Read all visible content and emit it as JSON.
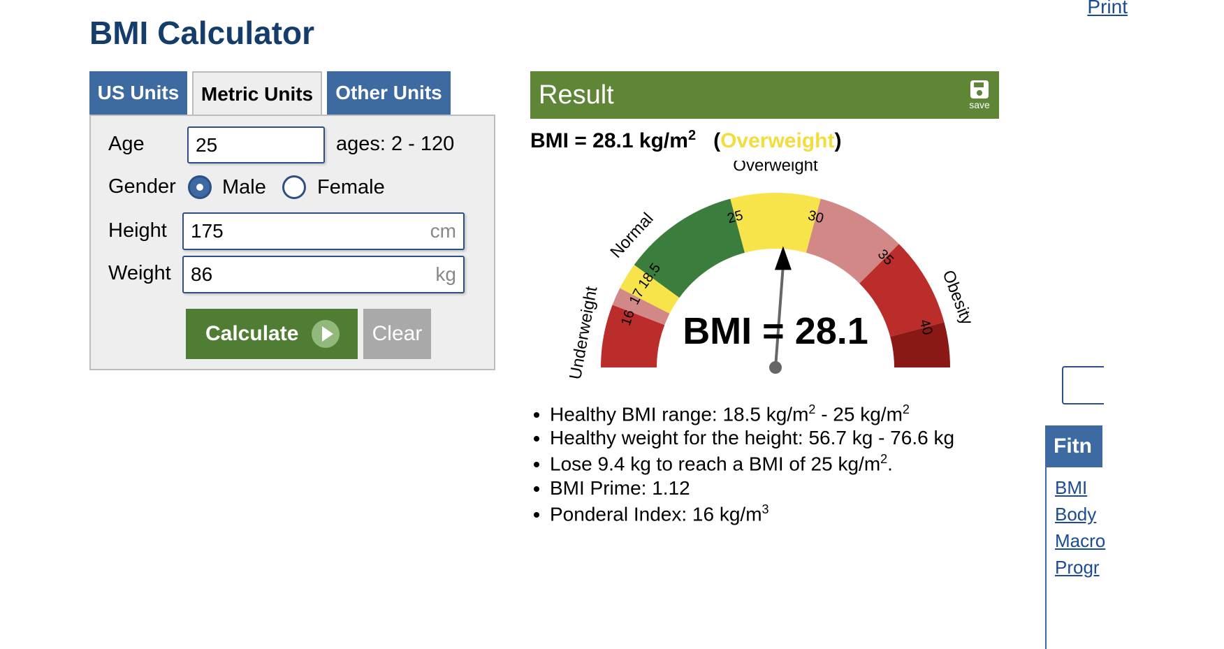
{
  "header": {
    "title": "BMI Calculator",
    "print_label": "Print"
  },
  "tabs": [
    {
      "label": "US Units",
      "active": false
    },
    {
      "label": "Metric Units",
      "active": true
    },
    {
      "label": "Other Units",
      "active": false
    }
  ],
  "form": {
    "age": {
      "label": "Age",
      "value": "25",
      "hint": "ages: 2 - 120"
    },
    "gender": {
      "label": "Gender",
      "options": [
        "Male",
        "Female"
      ],
      "selected": "Male"
    },
    "height": {
      "label": "Height",
      "value": "175",
      "unit": "cm"
    },
    "weight": {
      "label": "Weight",
      "value": "86",
      "unit": "kg"
    },
    "calculate_label": "Calculate",
    "clear_label": "Clear"
  },
  "result": {
    "title": "Result",
    "save_label": "save",
    "bmi_prefix": "BMI = 28.1 kg/m",
    "bmi_exp": "2",
    "category": "Overweight",
    "gauge": {
      "value": 28.1,
      "readout": "BMI = 28.1",
      "category_labels": [
        "Underweight",
        "Normal",
        "Overweight",
        "Obesity"
      ],
      "tick_labels": [
        "16",
        "17",
        "18.5",
        "25",
        "30",
        "35",
        "40"
      ],
      "colors": {
        "severe_under": "#bb2d2b",
        "moderate_under": "#d38888",
        "mild_under": "#f7e34a",
        "normal": "#3b7d3c",
        "overweight": "#f7e34a",
        "obese1": "#d38888",
        "obese2": "#bb2d2b",
        "obese3": "#8a1915"
      }
    },
    "details": {
      "healthy_range_prefix": "Healthy BMI range: 18.5 kg/m",
      "healthy_range_mid": " - 25 kg/m",
      "healthy_weight": "Healthy weight for the height: 56.7 kg - 76.6 kg",
      "lose_prefix": "Lose 9.4 kg to reach a BMI of 25 kg/m",
      "lose_suffix": ".",
      "bmi_prime": "BMI Prime: 1.12",
      "ponderal_prefix": "Ponderal Index: 16 kg/m",
      "ponderal_exp": "3",
      "sq_exp": "2"
    }
  },
  "side_nav": {
    "header": "Fitn",
    "links": [
      "BMI",
      "Body",
      "Macro",
      "Progr"
    ]
  }
}
